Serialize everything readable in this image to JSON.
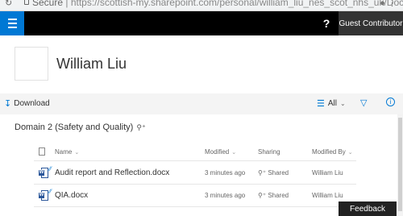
{
  "browser": {
    "secure_label": "Secure",
    "url": "https://scottish-my.sharepoint.com/personal/william_liu_nes_scot_nhs_uk/Docum"
  },
  "topbar": {
    "help_label": "?",
    "guest_label": "Guest Contributor",
    "accent_color": "#0078d4"
  },
  "profile": {
    "name": "William Liu"
  },
  "commandbar": {
    "download_label": "Download",
    "view_label": "All"
  },
  "library": {
    "title": "Domain 2 (Safety and Quality)",
    "columns": {
      "name": "Name",
      "modified": "Modified",
      "sharing": "Sharing",
      "modified_by": "Modified By"
    },
    "files": [
      {
        "name": "Audit report and Reflection.docx",
        "modified": "3 minutes ago",
        "sharing": "Shared",
        "modified_by": "William Liu"
      },
      {
        "name": "QIA.docx",
        "modified": "3 minutes ago",
        "sharing": "Shared",
        "modified_by": "William Liu"
      }
    ]
  },
  "feedback_label": "Feedback"
}
